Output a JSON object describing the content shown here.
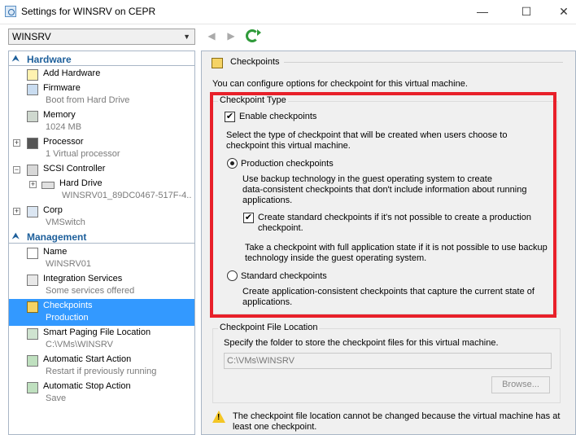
{
  "window": {
    "title": "Settings for WINSRV  on CEPR",
    "minimize": "—",
    "maximize": "☐",
    "close": "✕"
  },
  "toolbar": {
    "vm_selected": "WINSRV",
    "back": "◀",
    "forward": "▶"
  },
  "sidebar": {
    "sections": [
      {
        "label": "Hardware"
      },
      {
        "label": "Management"
      }
    ],
    "items": [
      {
        "label": "Add Hardware",
        "sub": ""
      },
      {
        "label": "Firmware",
        "sub": "Boot from Hard Drive"
      },
      {
        "label": "Memory",
        "sub": "1024 MB"
      },
      {
        "label": "Processor",
        "sub": "1 Virtual processor"
      },
      {
        "label": "SCSI Controller",
        "sub": ""
      },
      {
        "label": "Hard Drive",
        "sub": "WINSRV01_89DC0467-517F-4..."
      },
      {
        "label": "Corp",
        "sub": "VMSwitch"
      },
      {
        "label": "Name",
        "sub": "WINSRV01"
      },
      {
        "label": "Integration Services",
        "sub": "Some services offered"
      },
      {
        "label": "Checkpoints",
        "sub": "Production"
      },
      {
        "label": "Smart Paging File Location",
        "sub": "C:\\VMs\\WINSRV"
      },
      {
        "label": "Automatic Start Action",
        "sub": "Restart if previously running"
      },
      {
        "label": "Automatic Stop Action",
        "sub": "Save"
      }
    ],
    "selected_index": 9
  },
  "panel": {
    "header": "Checkpoints",
    "intro": "You can configure options for checkpoint for this virtual machine.",
    "checkpoint_type": {
      "title": "Checkpoint Type",
      "enable_label": "Enable checkpoints",
      "enable_checked": true,
      "select_desc_1": "Select the type of checkpoint that will be created when users choose to",
      "select_desc_2": "checkpoint this virtual machine.",
      "production_label": "Production checkpoints",
      "production_selected": true,
      "production_desc_1": "Use backup technology in the guest operating system to create",
      "production_desc_2": "data-consistent checkpoints that don't include information about running",
      "production_desc_3": "applications.",
      "standard_fallback_label_1": "Create standard checkpoints if it's not possible to create a production",
      "standard_fallback_label_2": "checkpoint.",
      "standard_fallback_checked": true,
      "fallback_desc_1": "Take a checkpoint with full application state if it is not possible to use backup",
      "fallback_desc_2": "technology inside the guest operating system.",
      "standard_label": "Standard checkpoints",
      "standard_selected": false,
      "standard_desc_1": "Create application-consistent checkpoints that capture the current state of",
      "standard_desc_2": "applications."
    },
    "file_location": {
      "title": "Checkpoint File Location",
      "desc": "Specify the folder to store the checkpoint files for this virtual machine.",
      "path_value": "C:\\VMs\\WINSRV",
      "browse_label": "Browse..."
    },
    "warning_1": "The checkpoint file location cannot be changed because the virtual machine has at",
    "warning_2": "least one checkpoint."
  },
  "colors": {
    "highlight": "#e8202a",
    "selection": "#3399ff",
    "section_header": "#1d5f9b"
  }
}
